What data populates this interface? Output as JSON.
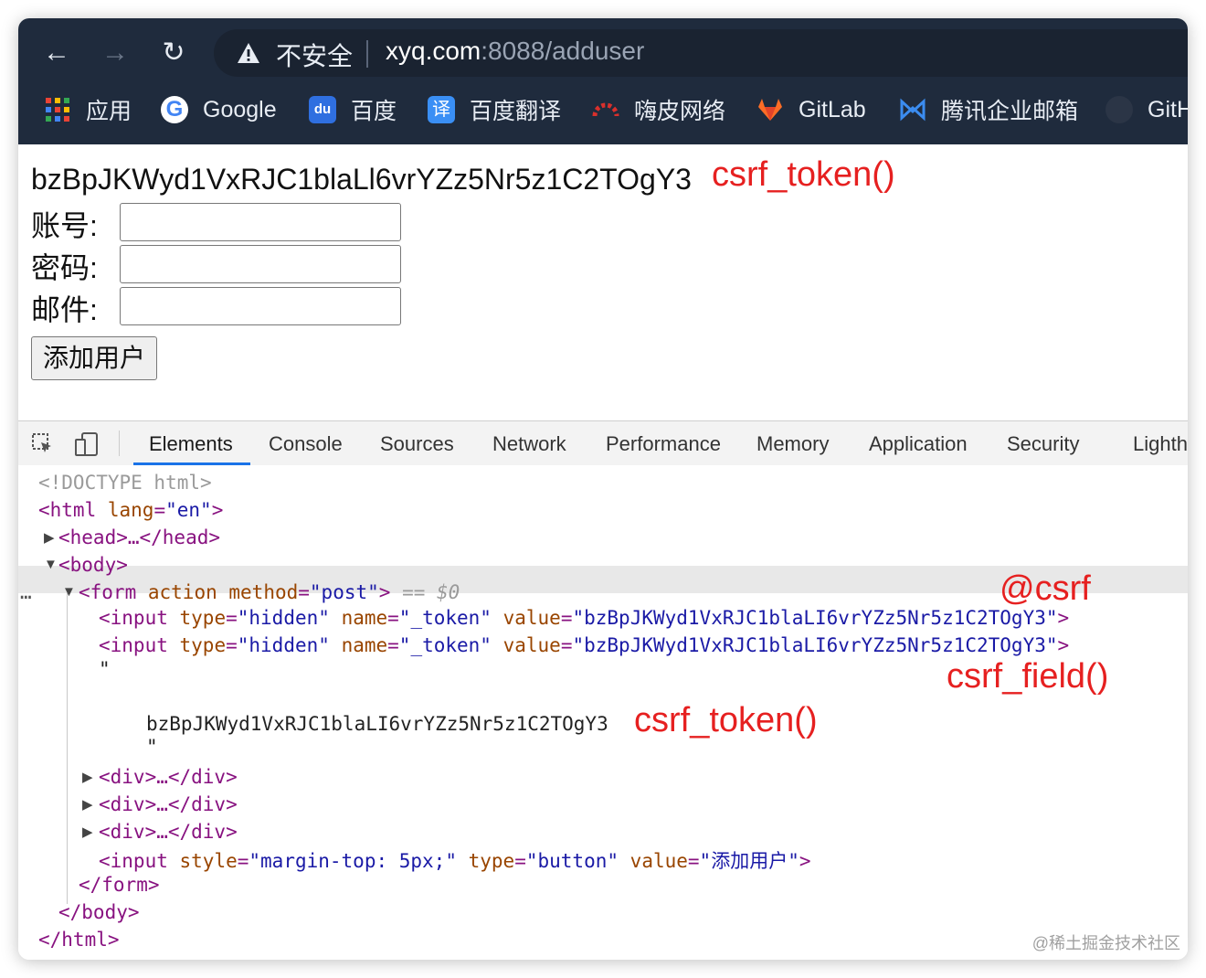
{
  "browser": {
    "nav": {
      "back": "←",
      "forward": "→",
      "reload": "↻"
    },
    "security_label": "不安全",
    "url_host": "xyq.com",
    "url_rest": ":8088/adduser",
    "bookmarks": [
      {
        "label": "应用",
        "icon": "apps-grid-icon"
      },
      {
        "label": "Google",
        "icon": "google-icon"
      },
      {
        "label": "百度",
        "icon": "baidu-icon"
      },
      {
        "label": "百度翻译",
        "icon": "translate-icon",
        "glyph": "译"
      },
      {
        "label": "嗨皮网络",
        "icon": "hipi-icon"
      },
      {
        "label": "GitLab",
        "icon": "gitlab-icon"
      },
      {
        "label": "腾讯企业邮箱",
        "icon": "tencent-mail-icon"
      },
      {
        "label": "GitH",
        "icon": "github-icon"
      }
    ]
  },
  "page": {
    "token": "bzBpJKWyd1VxRJC1blaLl6vrYZz5Nr5z1C2TOgY3",
    "fields": [
      {
        "label": "账号:",
        "value": ""
      },
      {
        "label": "密码:",
        "value": ""
      },
      {
        "label": "邮件:",
        "value": ""
      }
    ],
    "submit_label": "添加用户"
  },
  "annotations": {
    "top": "csrf_token()",
    "csrf": "@csrf",
    "field": "csrf_field()",
    "token": "csrf_token()"
  },
  "devtools": {
    "tabs": [
      "Elements",
      "Console",
      "Sources",
      "Network",
      "Performance",
      "Memory",
      "Application",
      "Security",
      "Lighth"
    ],
    "active_tab": "Elements",
    "lines": {
      "doctype": "<!DOCTYPE html>",
      "html_open_tag": "<html",
      "html_attr": "lang",
      "html_val": "\"en\"",
      "head": "<head>…</head>",
      "body_open": "<body>",
      "form_tag": "<form",
      "form_attr1": "action",
      "form_attr2": "method",
      "form_val": "\"post\"",
      "form_sel": "== $0",
      "input_tag": "<input",
      "type_attr": "type",
      "hidden_val": "\"hidden\"",
      "name_attr": "name",
      "token_name_val": "\"_token\"",
      "value_attr": "value",
      "token_val": "\"bzBpJKWyd1VxRJC1blaLI6vrYZz5Nr5z1C2TOgY3\"",
      "quote": "\"",
      "text_token": "bzBpJKWyd1VxRJC1blaLI6vrYZz5Nr5z1C2TOgY3",
      "div": "<div>…</div>",
      "style_attr": "style",
      "style_val": "\"margin-top: 5px;\"",
      "button_val": "\"button\"",
      "submit_val": "\"添加用户\"",
      "form_close": "</form>",
      "body_close": "</body>",
      "html_close": "</html>",
      "ellipsis": "…"
    }
  },
  "watermark": "@稀土掘金技术社区",
  "colors": {
    "chrome": "#1f2b3d",
    "annotation": "#e62020",
    "accent": "#1a73e8"
  }
}
